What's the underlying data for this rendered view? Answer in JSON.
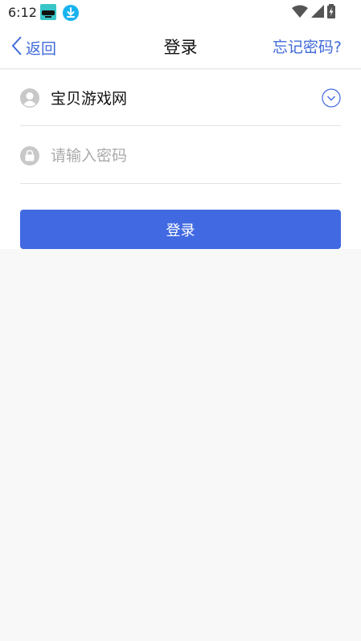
{
  "status_bar": {
    "time": "6:12",
    "icons": [
      "app-notification-icon",
      "download-icon",
      "wifi-icon",
      "cellular-signal-icon",
      "battery-charging-icon"
    ]
  },
  "nav": {
    "back_label": "返回",
    "title": "登录",
    "forgot_label": "忘记密码?"
  },
  "form": {
    "username_value": "宝贝游戏网",
    "password_placeholder": "请输入密码",
    "password_value": "",
    "login_label": "登录"
  },
  "colors": {
    "accent": "#3f6ad8",
    "button": "#4169e1",
    "background": "#f8f8f8",
    "divider": "#e3e3e3",
    "icon_gray": "#c8c8c8"
  }
}
